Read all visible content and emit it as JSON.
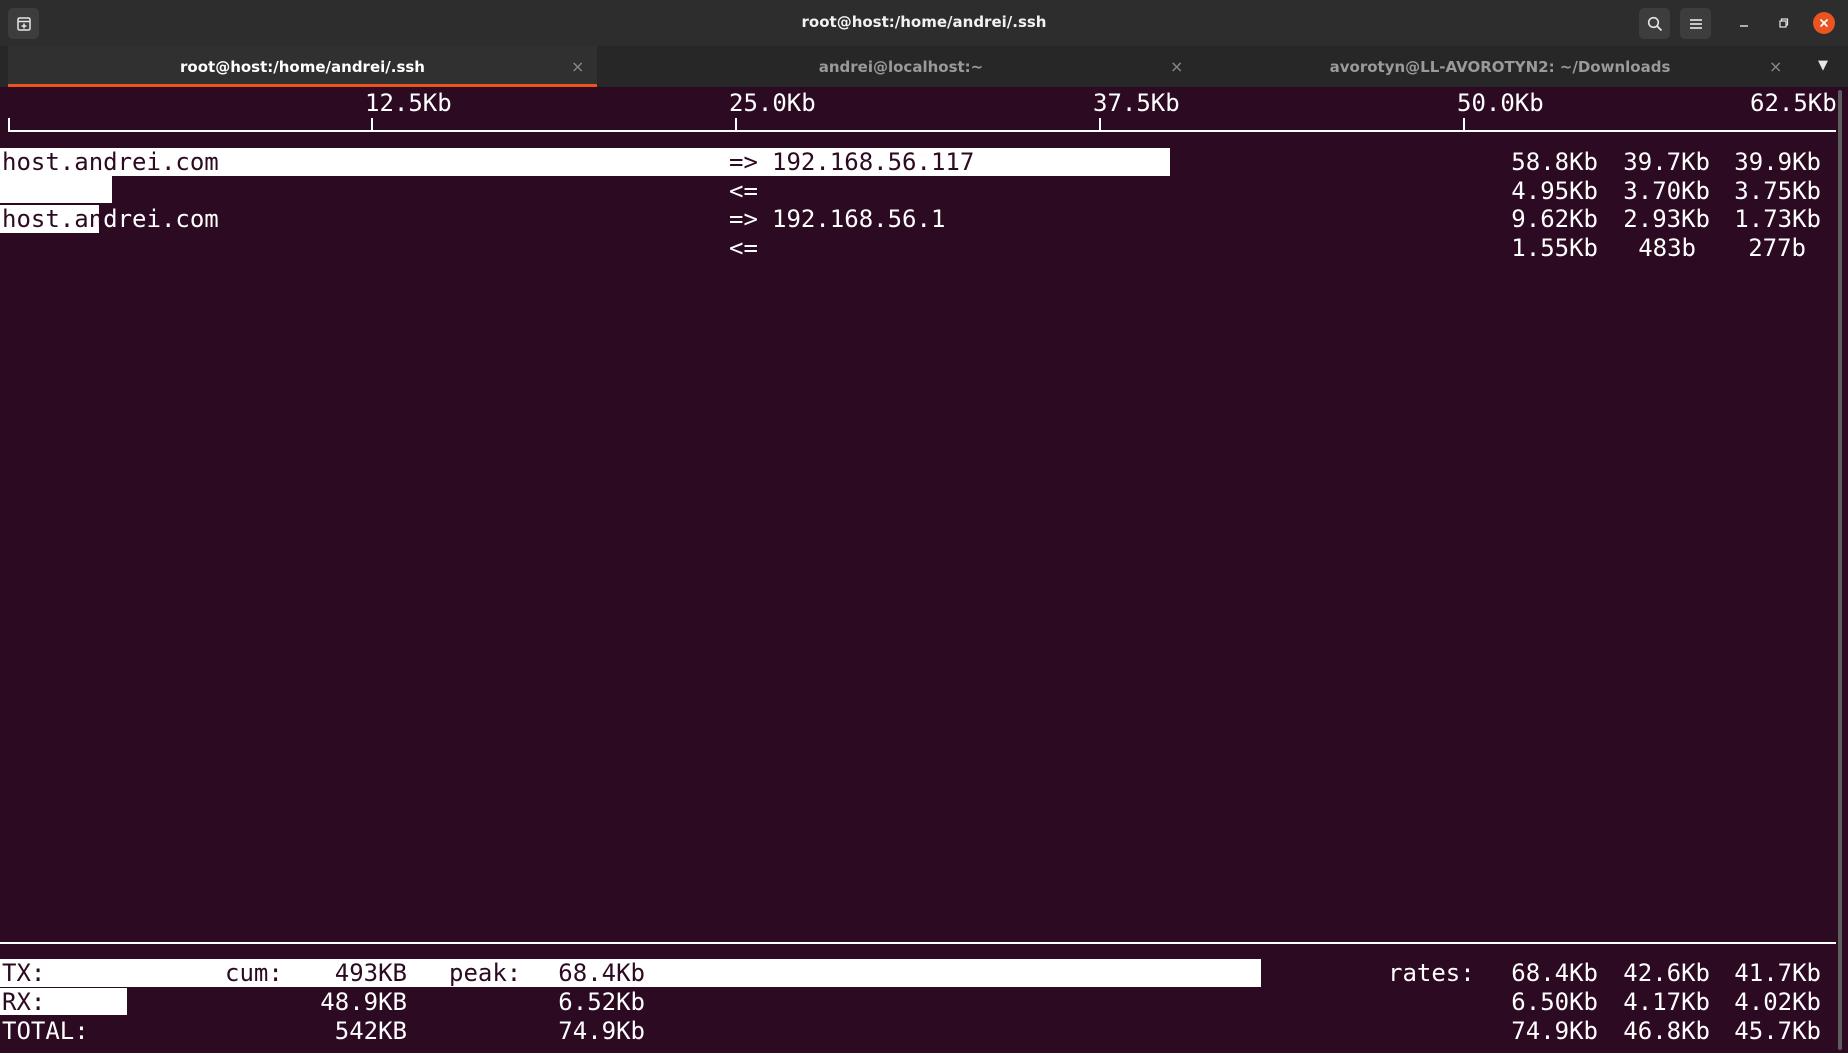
{
  "window": {
    "title": "root@host:/home/andrei/.ssh",
    "icons": [
      "new-tab-icon",
      "search-icon",
      "hamburger-menu-icon",
      "minimize-icon",
      "maximize-icon",
      "close-icon"
    ]
  },
  "tabs": [
    {
      "label": "root@host:/home/andrei/.ssh",
      "active": true
    },
    {
      "label": "andrei@localhost:~",
      "active": false
    },
    {
      "label": "avorotyn@LL-AVOROTYN2: ~/Downloads",
      "active": false
    }
  ],
  "scale": {
    "labels": [
      "12.5Kb",
      "25.0Kb",
      "37.5Kb",
      "50.0Kb",
      "62.5Kb"
    ]
  },
  "connections": [
    {
      "host": "host.andrei.com",
      "out_arrow": "=>",
      "remote": "192.168.56.117",
      "out_rates": [
        "58.8Kb",
        "39.7Kb",
        "39.9Kb"
      ],
      "in_arrow": "<=",
      "in_rates": [
        "4.95Kb",
        "3.70Kb",
        "3.75Kb"
      ],
      "bar_fraction": 0.637
    },
    {
      "host": "host.andrei.com",
      "host_hl_part": "host.an",
      "host_rest_part": "drei.com",
      "out_arrow": "=>",
      "remote": "192.168.56.1",
      "out_rates": [
        "9.62Kb",
        "2.93Kb",
        "1.73Kb"
      ],
      "in_arrow": "<=",
      "in_rates": [
        "1.55Kb",
        "483b",
        "277b"
      ]
    }
  ],
  "totals": {
    "tx_label": "TX:",
    "rx_label": "RX:",
    "total_label": "TOTAL:",
    "cum_label": "cum:",
    "peak_label": "peak:",
    "rates_label": "rates:",
    "tx": {
      "cum": "493KB",
      "peak": "68.4Kb",
      "rates": [
        "68.4Kb",
        "42.6Kb",
        "41.7Kb"
      ]
    },
    "rx": {
      "cum": "48.9KB",
      "peak": "6.52Kb",
      "rates": [
        "6.50Kb",
        "4.17Kb",
        "4.02Kb"
      ]
    },
    "total": {
      "cum": "542KB",
      "peak": "74.9Kb",
      "rates": [
        "74.9Kb",
        "46.8Kb",
        "45.7Kb"
      ]
    }
  },
  "colors": {
    "terminal_bg": "#2c0a22",
    "foreground": "#ffffff",
    "accent": "#e95420"
  }
}
